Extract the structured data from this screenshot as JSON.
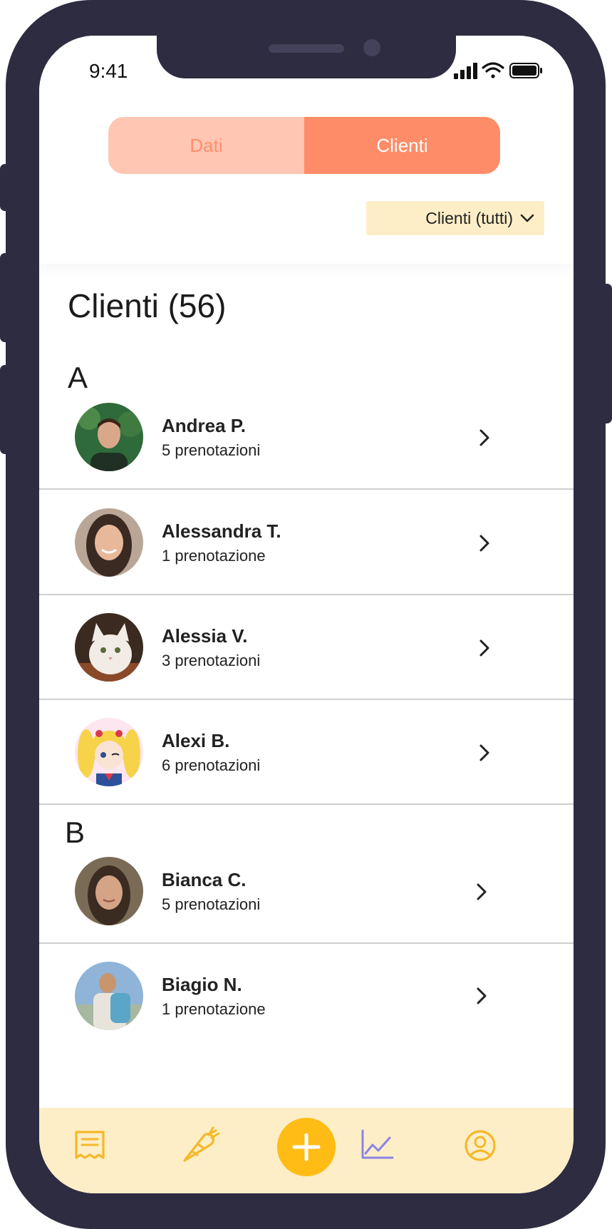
{
  "status_bar": {
    "time": "9:41"
  },
  "tabs": {
    "dati_label": "Dati",
    "clienti_label": "Clienti"
  },
  "filter": {
    "label": "Clienti (tutti)"
  },
  "page": {
    "title": "Clienti (56)"
  },
  "sections": [
    {
      "letter": "A",
      "clients": [
        {
          "name": "Andrea P.",
          "count": "5 prenotazioni"
        },
        {
          "name": "Alessandra T.",
          "count": "1 prenotazione"
        },
        {
          "name": "Alessia V.",
          "count": "3 prenotazioni"
        },
        {
          "name": "Alexi B.",
          "count": "6 prenotazioni"
        }
      ]
    },
    {
      "letter": "B",
      "clients": [
        {
          "name": "Bianca C.",
          "count": "5 prenotazioni"
        },
        {
          "name": "Biagio N.",
          "count": "1 prenotazione"
        }
      ]
    }
  ],
  "bottom_nav": {
    "items": [
      "receipt-icon",
      "carrot-icon",
      "plus-icon",
      "chart-line-icon",
      "user-circle-icon"
    ],
    "active": "chart-line-icon"
  },
  "colors": {
    "frame": "#2d2c40",
    "accent": "#ff8c68",
    "accent_light": "#ffc6b3",
    "dropdown_bg": "#fdeec7",
    "fab": "#ffbc14",
    "nav_icon": "#f5b82a",
    "nav_active": "#8a84e6"
  }
}
